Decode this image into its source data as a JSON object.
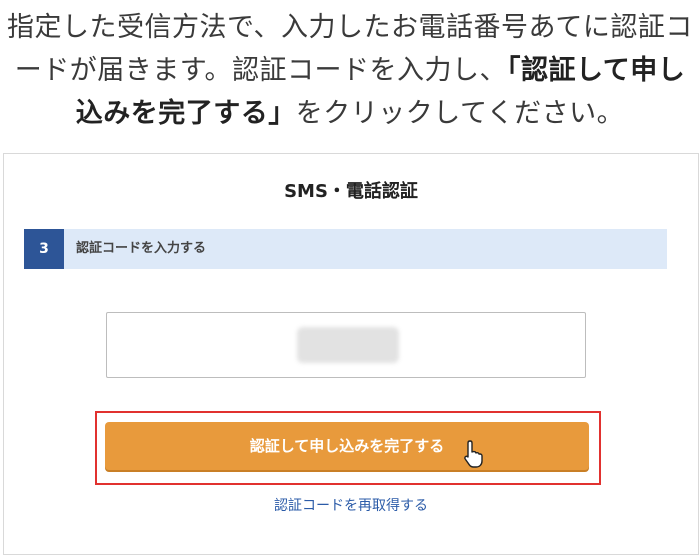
{
  "instructions": {
    "line1": "指定した受信方法で、入力したお電話番号あてに認証コ",
    "line2_plain": "ードが届きます。認証コードを入力し、",
    "line2_emph": "「認証して申し",
    "line3_emph": "込みを完了する」",
    "line3_plain": "をクリックしてください。"
  },
  "panel": {
    "title": "SMS・電話認証",
    "step": {
      "number": "3",
      "label": "認証コードを入力する"
    },
    "code_input": {
      "value": "",
      "note": "blurred"
    },
    "submit_label": "認証して申し込みを完了する",
    "resend_label": "認証コードを再取得する"
  },
  "colors": {
    "step_badge": "#2d5597",
    "step_bar": "#dde9f8",
    "button": "#e89a3c",
    "highlight": "#e1312f",
    "link": "#2b5ba8"
  },
  "icons": {
    "cursor": "pointer-cursor-icon"
  }
}
